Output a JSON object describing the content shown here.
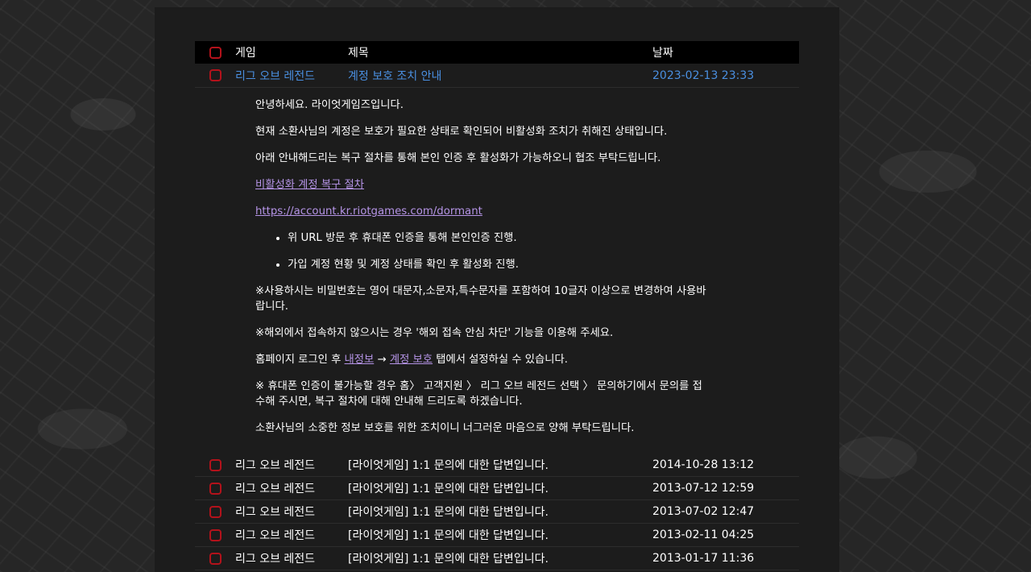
{
  "header": {
    "game": "게임",
    "title": "제목",
    "date": "날짜"
  },
  "open_row": {
    "game": "리그 오브 레전드",
    "title": "계정 보호 조치 안내",
    "date": "2023-02-13 23:33"
  },
  "message": {
    "greeting": "안녕하세요. 라이엇게임즈입니다.",
    "p1": "현재 소환사님의 계정은 보호가 필요한 상태로 확인되어 비활성화 조치가 취해진 상태입니다.",
    "p2": "아래 안내해드리는 복구 절차를 통해 본인 인증 후 활성화가 가능하오니 협조 부탁드립니다.",
    "link_label": "비활성화 계정 복구 절차",
    "link_url": "https://account.kr.riotgames.com/dormant",
    "bullets": [
      "위 URL 방문 후 휴대폰 인증을 통해 본인인증 진행.",
      "가입 계정 현황 및 계정 상태를 확인 후 활성화 진행."
    ],
    "password_note": "※사용하시는 비밀번호는 영어 대문자,소문자,특수문자를 포함하여 10글자 이상으로 변경하여 사용바랍니다.",
    "overseas_note": "※해외에서 접속하지 않으시는 경우 '해외 접속 안심 차단' 기능을 이용해 주세요.",
    "settings_prefix": "홈페이지 로그인 후 ",
    "settings_link1": "내정보",
    "settings_arrow": " → ",
    "settings_link2": "계정 보호",
    "settings_suffix": " 탭에서 설정하실 수 있습니다.",
    "phone_note": "※ 휴대폰 인증이 불가능할 경우 홈〉 고객지원 〉 리그 오브 레전드 선택 〉 문의하기에서 문의를 접수해 주시면, 복구 절차에 대해 안내해 드리도록 하겠습니다.",
    "closing": "소환사님의 소중한 정보 보호를 위한 조치이니 너그러운 마음으로 양해 부탁드립니다."
  },
  "rows": [
    {
      "game": "리그 오브 레전드",
      "title": "[라이엇게임] 1:1 문의에 대한 답변입니다.",
      "date": "2014-10-28 13:12"
    },
    {
      "game": "리그 오브 레전드",
      "title": "[라이엇게임] 1:1 문의에 대한 답변입니다.",
      "date": "2013-07-12 12:59"
    },
    {
      "game": "리그 오브 레전드",
      "title": "[라이엇게임] 1:1 문의에 대한 답변입니다.",
      "date": "2013-07-02 12:47"
    },
    {
      "game": "리그 오브 레전드",
      "title": "[라이엇게임] 1:1 문의에 대한 답변입니다.",
      "date": "2013-02-11 04:25"
    },
    {
      "game": "리그 오브 레전드",
      "title": "[라이엇게임] 1:1 문의에 대한 답변입니다.",
      "date": "2013-01-17 11:36"
    }
  ],
  "colors": {
    "checkbox_border": "#b3121b",
    "open_row_text": "#4a8fe0",
    "link": "#b594e6"
  }
}
